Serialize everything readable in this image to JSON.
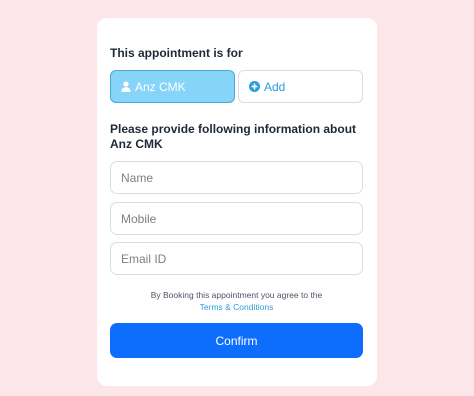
{
  "appointment": {
    "for_label": "This appointment is for",
    "selected_person": "Anz CMK",
    "add_label": "Add"
  },
  "info": {
    "heading": "Please provide following information about Anz CMK"
  },
  "form": {
    "name_placeholder": "Name",
    "mobile_placeholder": "Mobile",
    "email_placeholder": "Email ID"
  },
  "agreement": {
    "text": "By Booking this appointment you agree to the",
    "link_label": "Terms & Conditions"
  },
  "confirm_label": "Confirm",
  "colors": {
    "page_bg": "#fde6e9",
    "selected_bg": "#86d4f7",
    "accent_link": "#2a9fd6",
    "confirm_bg": "#0d6efd"
  },
  "icons": {
    "person": "user-icon",
    "add": "plus-circle-icon"
  }
}
